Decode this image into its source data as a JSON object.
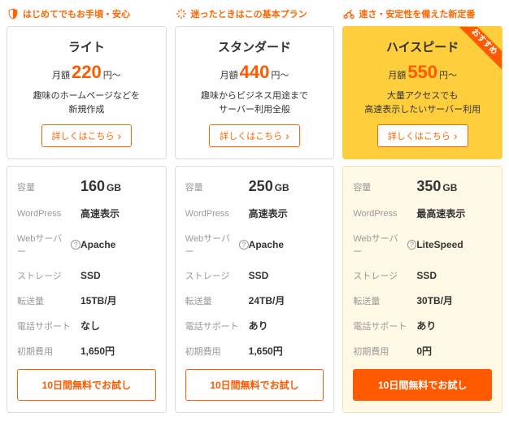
{
  "plans": [
    {
      "tagline": "はじめてでもお手頃・安心",
      "name": "ライト",
      "price_prefix": "月額",
      "price": "220",
      "price_suffix": "円～",
      "desc": "趣味のホームページなどを\n新規作成",
      "more": "詳しくはこちら",
      "featured": false,
      "specs": {
        "capacity_label": "容量",
        "capacity_value": "160",
        "capacity_unit": "GB",
        "wp_label": "WordPress",
        "wp_value": "高速表示",
        "web_label": "Webサーバー",
        "web_value": "Apache",
        "storage_label": "ストレージ",
        "storage_value": "SSD",
        "transfer_label": "転送量",
        "transfer_value": "15TB/月",
        "phone_label": "電話サポート",
        "phone_value": "なし",
        "init_label": "初期費用",
        "init_value": "1,650円"
      },
      "trial": "10日間無料でお試し"
    },
    {
      "tagline": "迷ったときはこの基本プラン",
      "name": "スタンダード",
      "price_prefix": "月額",
      "price": "440",
      "price_suffix": "円～",
      "desc": "趣味からビジネス用途まで\nサーバー利用全般",
      "more": "詳しくはこちら",
      "featured": false,
      "specs": {
        "capacity_label": "容量",
        "capacity_value": "250",
        "capacity_unit": "GB",
        "wp_label": "WordPress",
        "wp_value": "高速表示",
        "web_label": "Webサーバー",
        "web_value": "Apache",
        "storage_label": "ストレージ",
        "storage_value": "SSD",
        "transfer_label": "転送量",
        "transfer_value": "24TB/月",
        "phone_label": "電話サポート",
        "phone_value": "あり",
        "init_label": "初期費用",
        "init_value": "1,650円"
      },
      "trial": "10日間無料でお試し"
    },
    {
      "tagline": "速さ・安定性を備えた新定番",
      "name": "ハイスピード",
      "price_prefix": "月額",
      "price": "550",
      "price_suffix": "円～",
      "desc": "大量アクセスでも\n高速表示したいサーバー利用",
      "more": "詳しくはこちら",
      "featured": true,
      "ribbon": "おすすめ",
      "specs": {
        "capacity_label": "容量",
        "capacity_value": "350",
        "capacity_unit": "GB",
        "wp_label": "WordPress",
        "wp_value": "最高速表示",
        "web_label": "Webサーバー",
        "web_value": "LiteSpeed",
        "storage_label": "ストレージ",
        "storage_value": "SSD",
        "transfer_label": "転送量",
        "transfer_value": "30TB/月",
        "phone_label": "電話サポート",
        "phone_value": "あり",
        "init_label": "初期費用",
        "init_value": "0円"
      },
      "trial": "10日間無料でお試し"
    }
  ]
}
